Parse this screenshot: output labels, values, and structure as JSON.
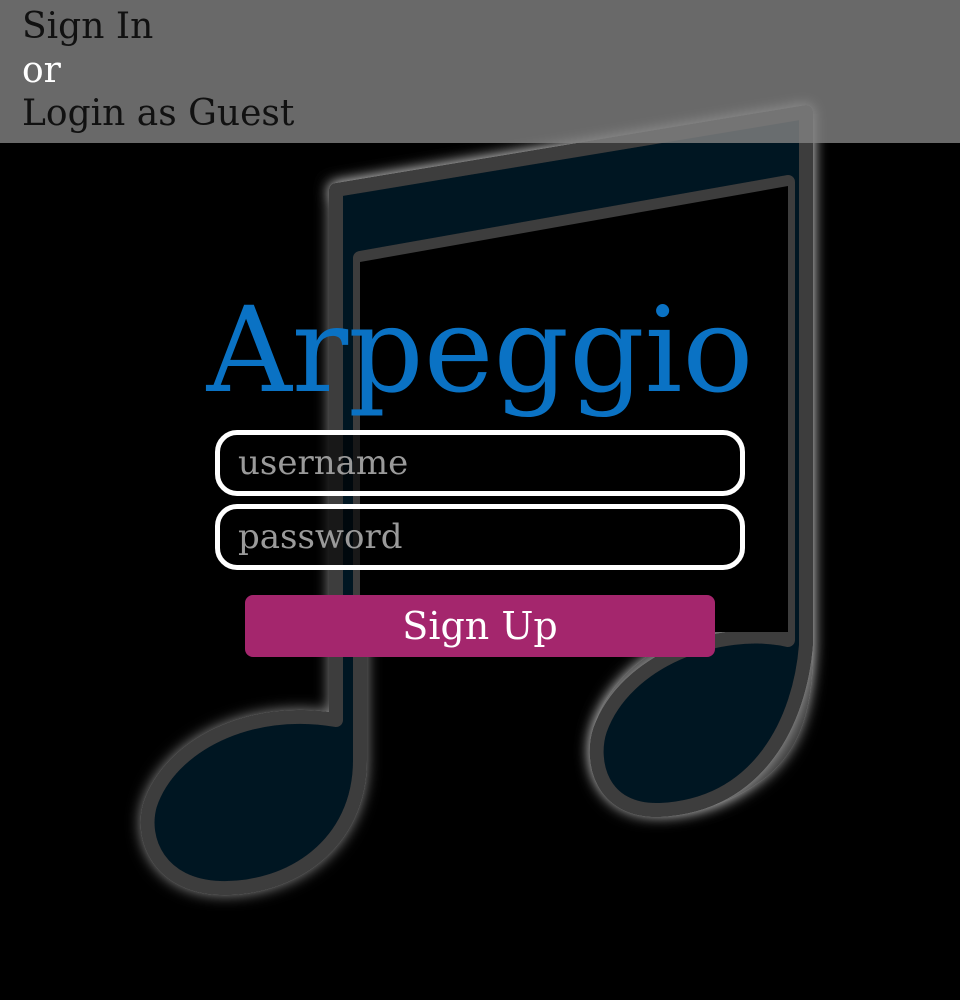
{
  "nav": {
    "sign_in": "Sign In",
    "or": "or",
    "guest": "Login as Guest"
  },
  "brand": {
    "title": "Arpeggio",
    "color": "#0a72c4"
  },
  "form": {
    "username_placeholder": "username",
    "password_placeholder": "password",
    "submit_label": "Sign Up",
    "submit_color": "#a4266d"
  },
  "background": {
    "icon": "music-note-icon",
    "color": "#001522"
  }
}
